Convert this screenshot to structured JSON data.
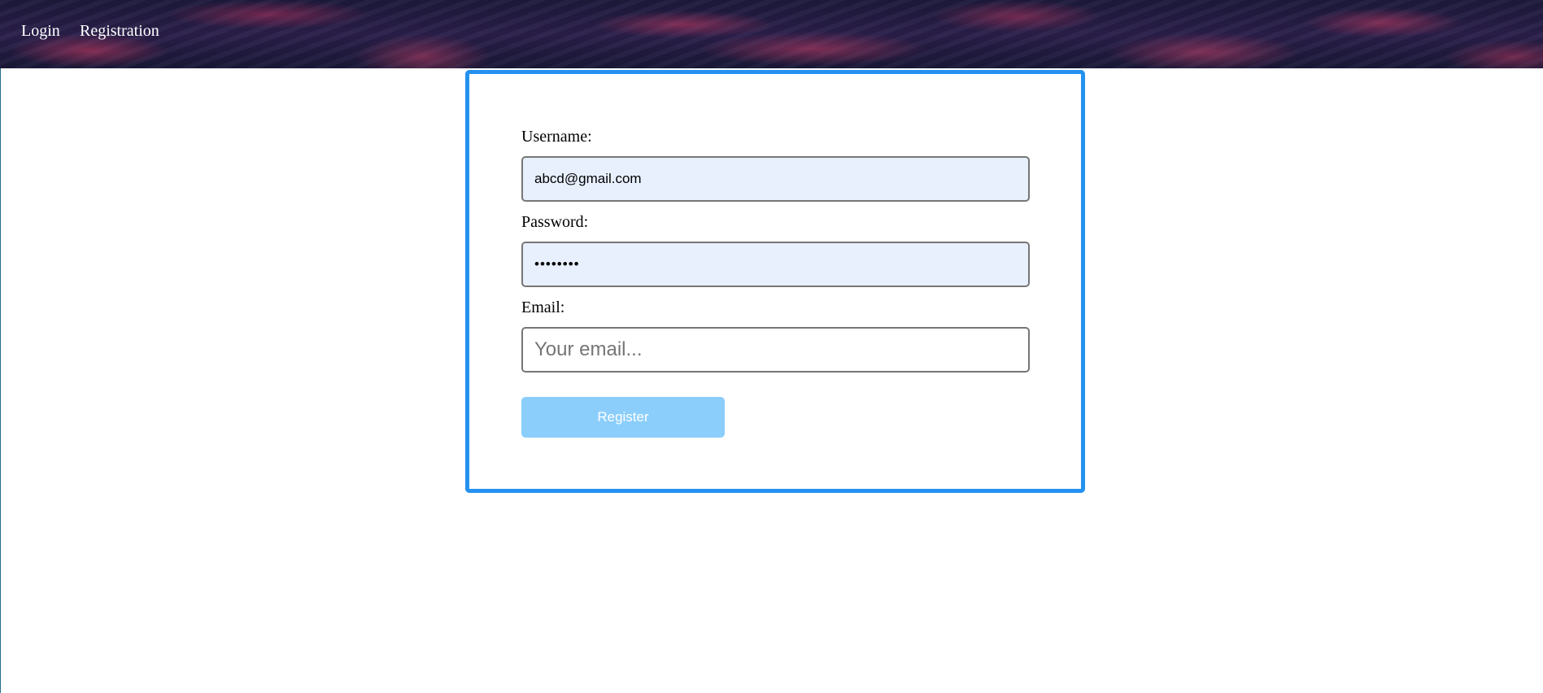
{
  "nav": {
    "links": [
      {
        "label": "Login"
      },
      {
        "label": "Registration"
      }
    ]
  },
  "form": {
    "username": {
      "label": "Username:",
      "value": "abcd@gmail.com"
    },
    "password": {
      "label": "Password:",
      "value": "••••••••"
    },
    "email": {
      "label": "Email:",
      "value": "",
      "placeholder": "Your email..."
    },
    "register_label": "Register"
  },
  "colors": {
    "card_border": "#2491f0",
    "autofill_background": "#e8f0fe",
    "button_background": "#8bcefb"
  }
}
